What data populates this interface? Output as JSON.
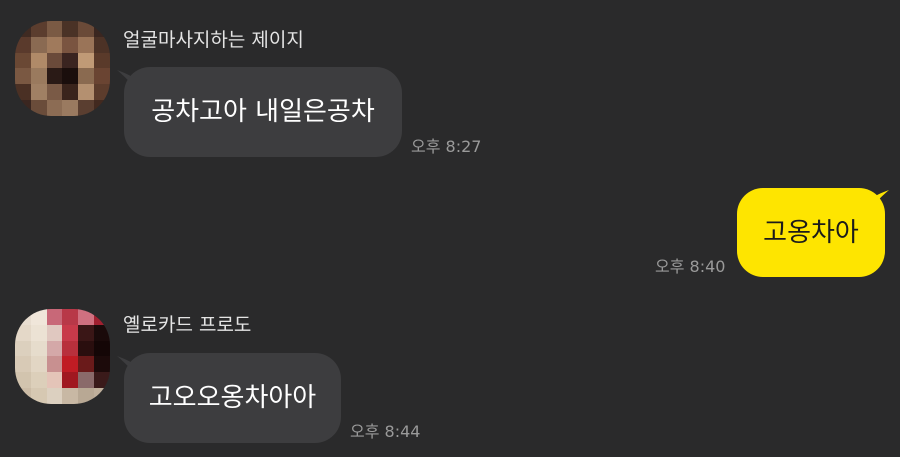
{
  "messages": [
    {
      "sender": "얼굴마사지하는 제이지",
      "avatar": "blurred-profile-photo",
      "text": "공차고아 내일은공차",
      "time": "오후 8:27",
      "direction": "incoming"
    },
    {
      "text": "고옹차아",
      "time": "오후 8:40",
      "direction": "outgoing"
    },
    {
      "sender": "옐로카드 프로도",
      "avatar": "blurred-profile-photo",
      "text": "고오오옹차아아",
      "time": "오후 8:44",
      "direction": "incoming"
    }
  ],
  "colors": {
    "background": "#2a2a2b",
    "incoming_bubble": "#3d3d3f",
    "outgoing_bubble": "#fee500",
    "sender_text": "#e4e4e4",
    "time_text": "#9a9a9a"
  }
}
